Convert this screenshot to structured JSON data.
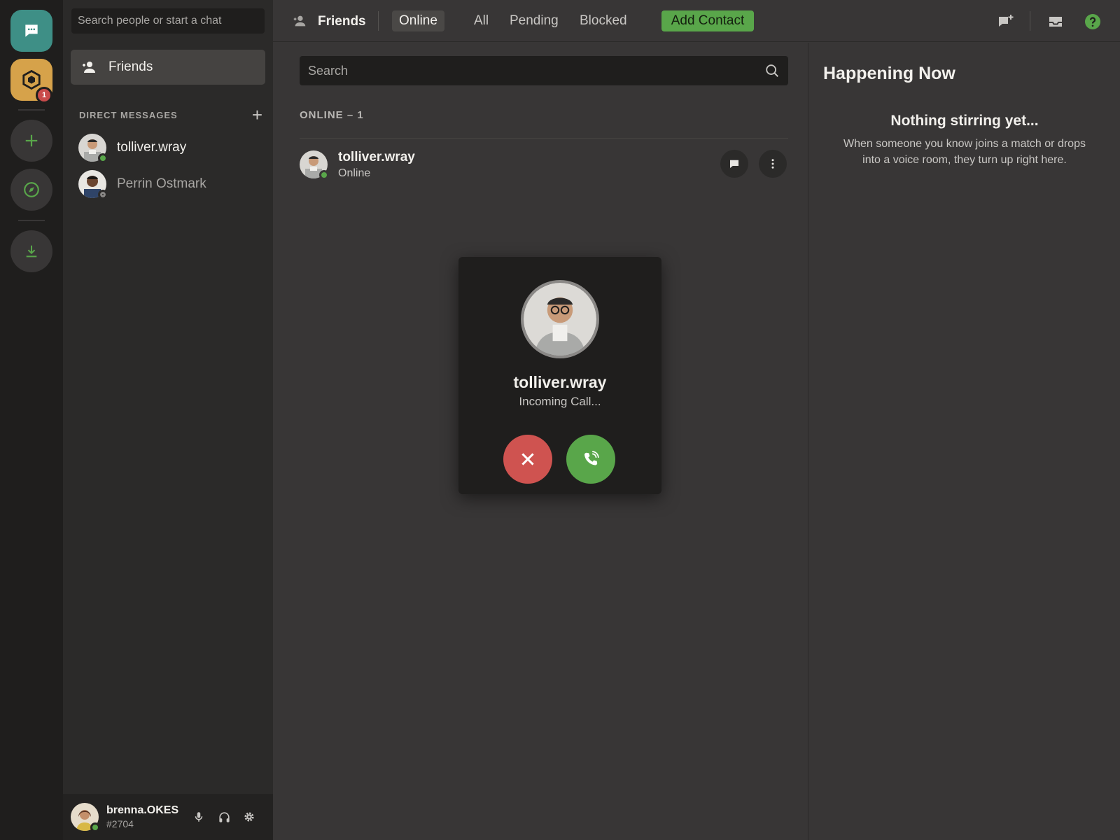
{
  "rail": {
    "server_badge": "1"
  },
  "sidebar": {
    "search_placeholder": "Search people or start a chat",
    "friends_label": "Friends",
    "dm_header": "DIRECT MESSAGES",
    "dms": [
      {
        "name": "tolliver.wray",
        "status": "online"
      },
      {
        "name": "Perrin Ostmark",
        "status": "offline"
      }
    ]
  },
  "user": {
    "name": "brenna.OKES",
    "tag": "#2704",
    "status": "online"
  },
  "topbar": {
    "title": "Friends",
    "tabs": [
      "Online",
      "All",
      "Pending",
      "Blocked"
    ],
    "active_tab": "Online",
    "add_contact": "Add Contact"
  },
  "main": {
    "search_placeholder": "Search",
    "online_header": "ONLINE – 1",
    "friends": [
      {
        "name": "tolliver.wray",
        "status": "Online"
      }
    ]
  },
  "happening": {
    "title": "Happening Now",
    "empty_title": "Nothing stirring yet...",
    "empty_text": "When someone you know joins a match or drops into a voice room, they turn up right here."
  },
  "call": {
    "caller": "tolliver.wray",
    "status": "Incoming Call..."
  },
  "colors": {
    "accent_green": "#59a64a",
    "decline_red": "#cf5350",
    "home_teal": "#3e8f86",
    "server_gold": "#d6a24a"
  }
}
